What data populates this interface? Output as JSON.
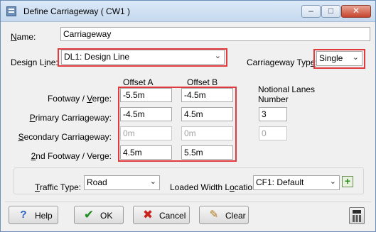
{
  "window": {
    "title": "Define Carriageway ( CW1 )",
    "min_glyph": "–",
    "max_glyph": "□",
    "close_glyph": "✕"
  },
  "name": {
    "label": "Name:",
    "value": "Carriageway"
  },
  "design_line": {
    "label": "Design Line:",
    "value": "DL1: Design Line"
  },
  "carriageway_type": {
    "label": "Carriageway Type:",
    "value": "Single"
  },
  "columns": {
    "offset_a": "Offset A",
    "offset_b": "Offset B",
    "notional_lanes_line1": "Notional Lanes",
    "notional_lanes_line2": "Number"
  },
  "rows": [
    {
      "label": "Footway / Verge:",
      "offset_a": "-5.5m",
      "offset_b": "-4.5m",
      "lanes": ""
    },
    {
      "label": "Primary Carriageway:",
      "offset_a": "-4.5m",
      "offset_b": "4.5m",
      "lanes": "3"
    },
    {
      "label": "Secondary Carriageway:",
      "offset_a": "0m",
      "offset_b": "0m",
      "lanes": "0"
    },
    {
      "label": "2nd Footway / Verge:",
      "offset_a": "4.5m",
      "offset_b": "5.5m",
      "lanes": ""
    }
  ],
  "traffic_type": {
    "label": "Traffic Type:",
    "value": "Road"
  },
  "loaded_width": {
    "label": "Loaded Width Location:",
    "value": "CF1: Default"
  },
  "buttons": {
    "help": "Help",
    "ok": "OK",
    "cancel": "Cancel",
    "clear": "Clear"
  },
  "icons": {
    "help": "question-icon",
    "ok": "checkmark-icon",
    "cancel": "x-icon",
    "clear": "eraser-icon",
    "calculator": "calculator-icon",
    "add": "plus-icon"
  },
  "colors": {
    "highlight": "#e0393e",
    "ok_green": "#1e8c1e",
    "cancel_red": "#c8231d",
    "help_blue": "#2a5fbf"
  }
}
